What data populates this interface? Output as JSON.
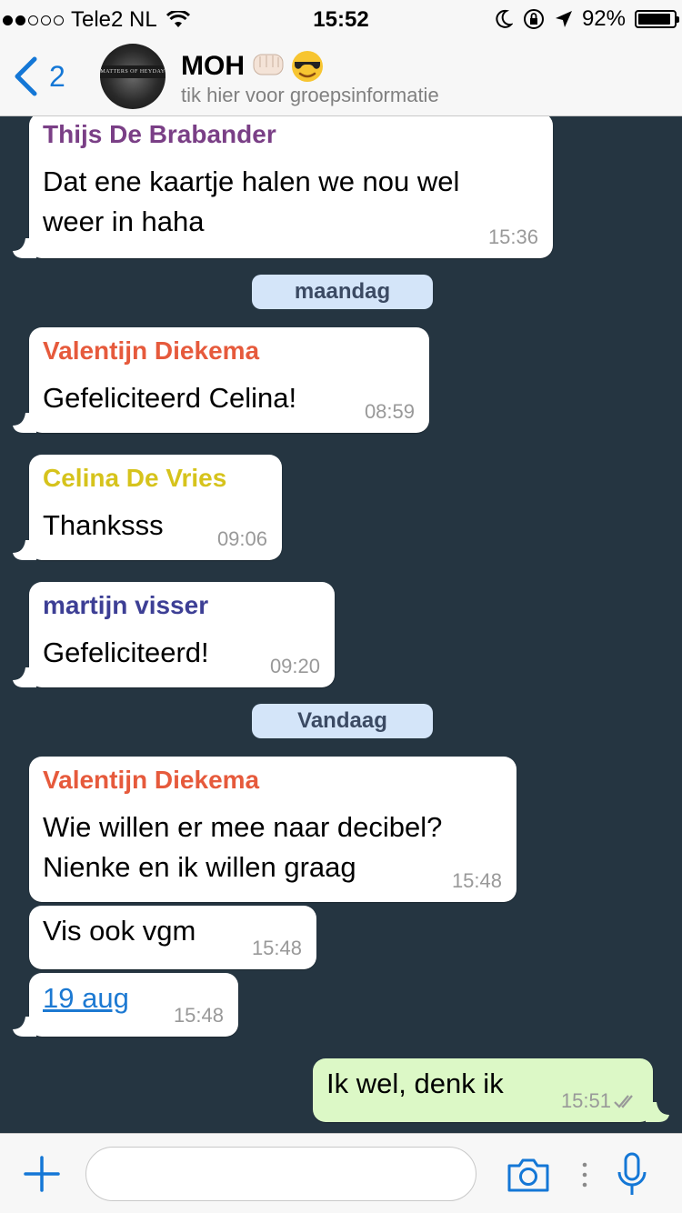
{
  "status_bar": {
    "signal_filled": 2,
    "signal_total": 5,
    "carrier": "Tele2 NL",
    "time": "15:52",
    "battery_text": "92%",
    "battery_level": 0.92
  },
  "nav": {
    "back_count": "2",
    "group_avatar_text": "MATTERS OF HEYDAY",
    "title": "MOH",
    "subtitle": "tik hier voor groepsinformatie"
  },
  "colors": {
    "accent": "#1477d6",
    "chat_background": "#253541",
    "outgoing_bubble": "#dcf8c6",
    "day_separator": "#d4e5f9",
    "sender_thijs": "#7a3f86",
    "sender_valentijn": "#e65a3c",
    "sender_celina": "#d6c31c",
    "sender_martijn": "#3d3f95"
  },
  "messages": [
    {
      "sender": "Thijs De Brabander",
      "lines": [
        "Dat ene kaartje halen we nou wel",
        "weer in haha"
      ],
      "time": "15:36"
    },
    {
      "separator": "maandag"
    },
    {
      "sender": "Valentijn Diekema",
      "lines": [
        "Gefeliciteerd Celina!"
      ],
      "time": "08:59"
    },
    {
      "sender": "Celina De Vries",
      "lines": [
        "Thanksss"
      ],
      "time": "09:06"
    },
    {
      "sender": "martijn visser",
      "lines": [
        "Gefeliciteerd!"
      ],
      "time": "09:20"
    },
    {
      "separator": "Vandaag"
    },
    {
      "sender": "Valentijn Diekema",
      "lines": [
        "Wie willen er mee naar decibel?",
        "Nienke en ik willen graag"
      ],
      "time": "15:48"
    },
    {
      "lines": [
        "Vis ook vgm"
      ],
      "time": "15:48"
    },
    {
      "link": "19 aug",
      "time": "15:48"
    },
    {
      "outgoing": true,
      "lines": [
        "Ik wel, denk ik"
      ],
      "time": "15:51",
      "status": "read-double-check"
    }
  ],
  "icons": {
    "back": "chevron-left-icon",
    "add": "plus-icon",
    "camera": "camera-icon",
    "more": "vertical-dots-icon",
    "mic": "microphone-icon",
    "wifi": "wifi-icon",
    "moon": "moon-icon",
    "rotation_lock": "rotation-lock-icon",
    "location": "location-arrow-icon"
  }
}
